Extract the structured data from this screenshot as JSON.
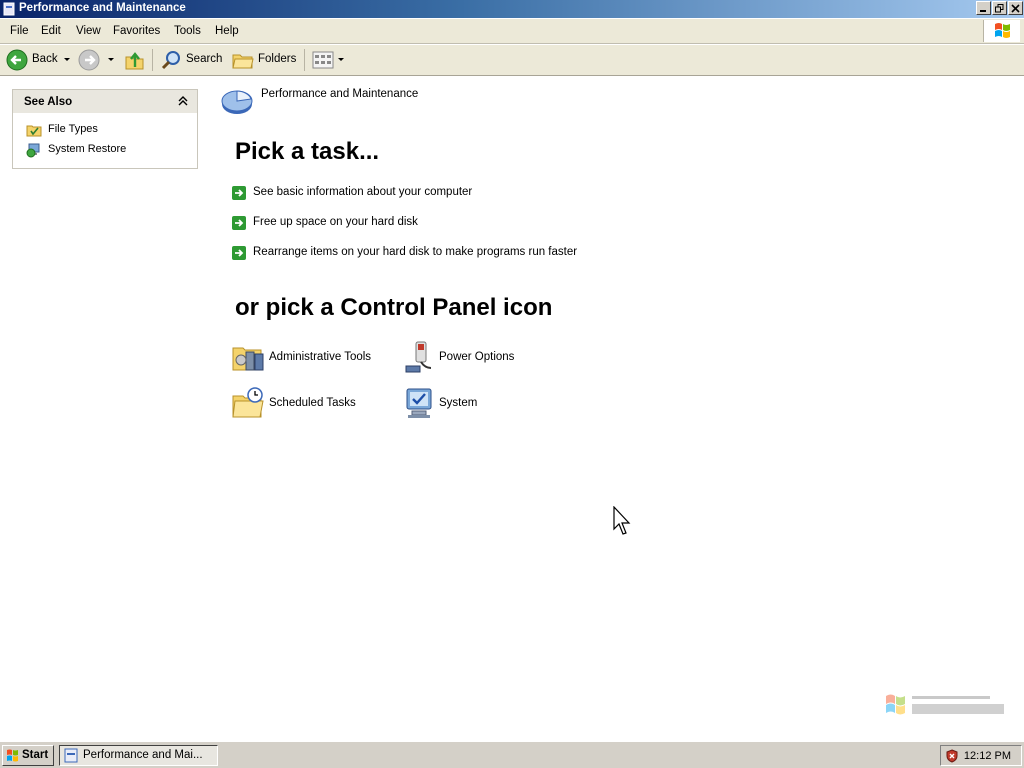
{
  "window": {
    "title": "Performance and Maintenance"
  },
  "menu": [
    "File",
    "Edit",
    "View",
    "Favorites",
    "Tools",
    "Help"
  ],
  "toolbar": {
    "back": "Back",
    "search": "Search",
    "folders": "Folders"
  },
  "see_also": {
    "title": "See Also",
    "items": [
      {
        "label": "File Types",
        "icon": "file-types-icon"
      },
      {
        "label": "System Restore",
        "icon": "system-restore-icon"
      }
    ]
  },
  "main": {
    "category_title": "Performance and Maintenance",
    "task_heading": "Pick a task...",
    "tasks": [
      "See basic information about your computer",
      "Free up space on your hard disk",
      "Rearrange items on your hard disk to make programs run faster"
    ],
    "icon_heading": "or pick a Control Panel icon",
    "icons": [
      {
        "label": "Administrative Tools",
        "icon": "administrative-tools-icon"
      },
      {
        "label": "Power Options",
        "icon": "power-options-icon"
      },
      {
        "label": "Scheduled Tasks",
        "icon": "scheduled-tasks-icon"
      },
      {
        "label": "System",
        "icon": "system-icon"
      }
    ]
  },
  "taskbar": {
    "start": "Start",
    "window_button": "Performance and Mai...",
    "clock": "12:12 PM"
  },
  "colors": {
    "titlebar": "#0a246a",
    "task_arrow": "#2e9a33"
  }
}
